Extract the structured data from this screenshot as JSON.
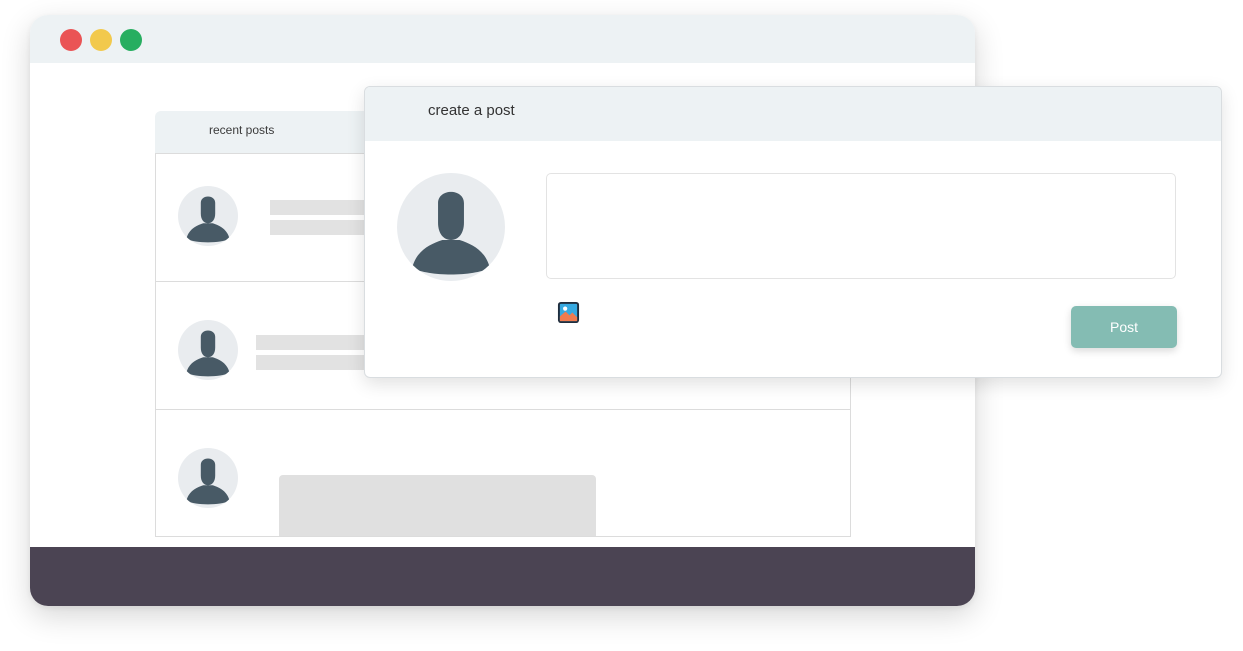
{
  "feed": {
    "header_label": "recent posts",
    "posts": [
      {
        "type": "text"
      },
      {
        "type": "text"
      },
      {
        "type": "image"
      }
    ]
  },
  "create_post": {
    "title": "create a post",
    "input_value": "",
    "input_placeholder": "",
    "add_image_icon": "image-icon",
    "post_label": "Post"
  },
  "colors": {
    "titlebar": "#edf2f4",
    "footer": "#4b4453",
    "post_button": "#84bcb3",
    "avatar_figure": "#485a66",
    "close_dot": "#ea5455",
    "minimize_dot": "#f2c94c",
    "maximize_dot": "#27ae60"
  }
}
